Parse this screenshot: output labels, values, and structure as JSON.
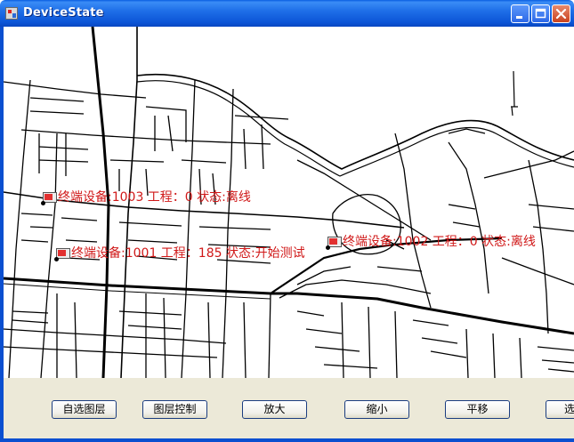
{
  "window": {
    "title": "DeviceState"
  },
  "devices": [
    {
      "label": "终端设备:1003 工程：0 状态:离线"
    },
    {
      "label": "终端设备:1001 工程：185 状态:开始测试"
    },
    {
      "label": "终端设备:1002 工程：0 状态:离线"
    }
  ],
  "toolbar": {
    "buttons": [
      {
        "label": "自选图层"
      },
      {
        "label": "图层控制"
      },
      {
        "label": "放大"
      },
      {
        "label": "缩小"
      },
      {
        "label": "平移"
      },
      {
        "label": "选"
      }
    ]
  },
  "colors": {
    "title_bar": "#1f6fe8",
    "device_label": "#d01818",
    "panel": "#ece9d8",
    "map_background": "#ffffff"
  }
}
